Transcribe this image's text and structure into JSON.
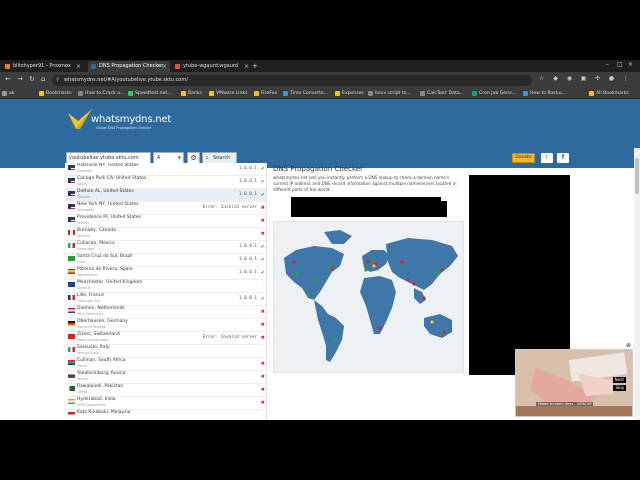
{
  "browser": {
    "tabs": [
      {
        "label": "blitzhyper91 - Proxmox",
        "color": "#e67e22"
      },
      {
        "label": "DNS Propagation Checker",
        "color": "#2f6a9f"
      },
      {
        "label": "ytube-wgaurd.wgaurd",
        "color": "#e74c3c"
      }
    ],
    "url": "whatsmydns.net/#A/youtubelive.ytube.sktu.com/",
    "bookmarks": [
      {
        "label": "ak",
        "color": "#999"
      },
      {
        "label": "Bookmarks",
        "color": "#f1c40f"
      },
      {
        "label": "How to Crack a...",
        "color": "#888"
      },
      {
        "label": "Speedtest.net...",
        "color": "#2ecc71"
      },
      {
        "label": "Banks",
        "color": "#f1c40f"
      },
      {
        "label": "VMware Links",
        "color": "#f1c40f"
      },
      {
        "label": "FireFox",
        "color": "#f1c40f"
      },
      {
        "label": "Time Converte...",
        "color": "#3498db"
      },
      {
        "label": "Expenses",
        "color": "#f1c40f"
      },
      {
        "label": "linux script to...",
        "color": "#888"
      },
      {
        "label": "CalcTool: Data...",
        "color": "#888"
      },
      {
        "label": "Cron Job Gene...",
        "color": "#16a085"
      },
      {
        "label": "How to Backu...",
        "color": "#3498db"
      },
      {
        "label": "All Bookmarks",
        "color": "#f1c40f"
      }
    ]
  },
  "site": {
    "logo_text": "whatsmydns.net",
    "logo_sub": "Global DNS Propagation Checker",
    "domain_value": "youtubelive.ytube.sktu.com",
    "record_type": "A",
    "search_label": "Search",
    "donate_label": "Donate",
    "twitter_icon": "t",
    "facebook_icon": "f"
  },
  "results": [
    {
      "loc": "Holtsville NY, United States",
      "prov": "OpenDNS",
      "ip": "1.0.0.1",
      "status": "ok",
      "flag": "us"
    },
    {
      "loc": "Canoga Park CA, United States",
      "prov": "Sprint",
      "ip": "1.0.0.1",
      "status": "ok",
      "flag": "us"
    },
    {
      "loc": "Dothan AL, United States",
      "prov": "Comodo",
      "ip": "1.0.0.1",
      "status": "ok",
      "flag": "us",
      "hl": true
    },
    {
      "loc": "New York NY, United States",
      "prov": "Speakeasy",
      "ip": "Error: Invalid server",
      "status": "bad",
      "flag": "us"
    },
    {
      "loc": "Providence RI, United States",
      "prov": "Verizon",
      "ip": "",
      "status": "bad",
      "flag": "us"
    },
    {
      "loc": "Burnaby, Canada",
      "prov": "Fortinet",
      "ip": "",
      "status": "bad",
      "flag": "ca"
    },
    {
      "loc": "Culiacan, Mexico",
      "prov": "Megacable",
      "ip": "1.0.0.1",
      "status": "ok",
      "flag": "mx"
    },
    {
      "loc": "Santa Cruz do Sul, Brazil",
      "prov": "Claro",
      "ip": "1.0.0.1",
      "status": "ok",
      "flag": "br"
    },
    {
      "loc": "Paterna de Rivera, Spain",
      "prov": "Servihosting",
      "ip": "1.0.0.1",
      "status": "ok",
      "flag": "es"
    },
    {
      "loc": "Manchester, United Kingdom",
      "prov": "Airnet It",
      "ip": "",
      "status": "none",
      "flag": "uk"
    },
    {
      "loc": "Lille, France",
      "prov": "Completel SAS",
      "ip": "1.0.0.1",
      "status": "ok",
      "flag": "fr"
    },
    {
      "loc": "Diemen, Netherlands",
      "prov": "Tele2 Nederland",
      "ip": "",
      "status": "bad",
      "flag": "nl"
    },
    {
      "loc": "Oberhausen, Germany",
      "prov": "Deutsche Telekom",
      "ip": "",
      "status": "bad",
      "flag": "de"
    },
    {
      "loc": "Zizers, Switzerland",
      "prov": "Oskar Emmenegger",
      "ip": "Error: Invalid server",
      "status": "bad",
      "flag": "ch"
    },
    {
      "loc": "Sassuolo, Italy",
      "prov": "Telecom Italia",
      "ip": "",
      "status": "none",
      "flag": "it"
    },
    {
      "loc": "Cullinan, South Africa",
      "prov": "Liquid",
      "ip": "",
      "status": "bad",
      "flag": "za"
    },
    {
      "loc": "Yekaterinburg, Russia",
      "prov": "Skynet",
      "ip": "",
      "status": "bad",
      "flag": "ru"
    },
    {
      "loc": "Rawalpindi, Pakistan",
      "prov": "CMPak",
      "ip": "",
      "status": "bad",
      "flag": "pk"
    },
    {
      "loc": "Hyderabad, India",
      "prov": "CFSS Datacenters",
      "ip": "",
      "status": "bad",
      "flag": "in"
    },
    {
      "loc": "Kota Kinabalu, Malaysia",
      "prov": "",
      "ip": "",
      "status": "none",
      "flag": "my"
    }
  ],
  "content": {
    "title": "DNS Propagation Checker",
    "desc": "whatsmydns.net lets you instantly perform a DNS lookup to check a domain name's current IP address and DNS record information against multiple nameservers located in different parts of the world."
  },
  "video_ad": {
    "next_label": "Next",
    "skip_label": "Skip",
    "caption": "Home to early days - SIGN UP"
  },
  "colors": {
    "header_blue": "#2f6a9f",
    "ok_green": "#2aa32a",
    "error_red": "#d22",
    "map_land": "#3f78a8"
  }
}
